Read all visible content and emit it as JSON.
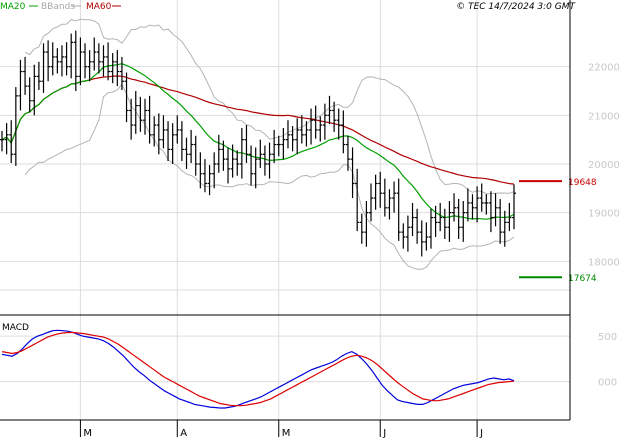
{
  "legend": [
    {
      "label": "MA20",
      "color": "#00a000"
    },
    {
      "label": "BBands",
      "color": "#a8a8a8"
    },
    {
      "label": "MA60",
      "color": "#b00000"
    }
  ],
  "copyright": "© TEC 14/7/2024 3:0 GMT",
  "macd_label": "MACD",
  "colors": {
    "ma20": "#00a000",
    "ma60": "#b00000",
    "bbands": "#b4b4b4",
    "price": "#000000",
    "macd": "#0000dd",
    "signal": "#dd0000",
    "grid": "#dddddd",
    "axis_text": "#c8c8c8",
    "resistance": "#cc0000",
    "support": "#008800"
  },
  "chart_data": [
    {
      "type": "bar",
      "title": "",
      "series_kind": "OHLC daily",
      "y_ticks": [
        {
          "value": 18000,
          "label": "18000"
        },
        {
          "value": 19000,
          "label": "19000"
        },
        {
          "value": 20000,
          "label": "20000"
        },
        {
          "value": 21000,
          "label": "21000"
        },
        {
          "value": 22000,
          "label": "22000"
        }
      ],
      "ylim": [
        17000,
        23000
      ],
      "x_ticks": [
        {
          "index": 17,
          "label": "M"
        },
        {
          "index": 38,
          "label": "A"
        },
        {
          "index": 60,
          "label": "M"
        },
        {
          "index": 82,
          "label": "J"
        },
        {
          "index": 103,
          "label": "J"
        }
      ],
      "n_days": 115,
      "closes": [
        20500,
        20600,
        20200,
        21400,
        21900,
        21600,
        21300,
        21800,
        21700,
        22300,
        22000,
        22200,
        22100,
        22200,
        22000,
        22500,
        21800,
        22300,
        22000,
        22100,
        22300,
        22100,
        22200,
        21900,
        22100,
        21900,
        21700,
        21100,
        20800,
        21200,
        20900,
        21100,
        20600,
        20800,
        20500,
        20700,
        20300,
        20600,
        20700,
        20300,
        20200,
        20400,
        20000,
        19800,
        19600,
        19800,
        20000,
        20300,
        20100,
        19900,
        20100,
        20000,
        20500,
        20200,
        19800,
        20100,
        20200,
        20000,
        20200,
        20400,
        20400,
        20500,
        20600,
        20500,
        20700,
        20600,
        20700,
        20900,
        20700,
        20800,
        21000,
        21100,
        20900,
        20800,
        20400,
        20100,
        19600,
        18800,
        18600,
        19000,
        19300,
        19600,
        19400,
        19100,
        19300,
        19400,
        18600,
        18500,
        18700,
        18900,
        18600,
        18400,
        18500,
        18900,
        18800,
        18900,
        18700,
        19000,
        19100,
        18700,
        19000,
        19200,
        19100,
        19300,
        19200,
        19200,
        18900,
        19100,
        18600,
        18800,
        18900,
        19400
      ],
      "levels": [
        {
          "name": "resistance",
          "value": 19648,
          "label": "19648"
        },
        {
          "name": "support",
          "value": 17674,
          "label": "17674"
        }
      ],
      "indicators": [
        "MA20",
        "MA60",
        "BBands"
      ]
    },
    {
      "type": "line",
      "title": "MACD",
      "y_ticks": [
        {
          "value": 500,
          "label": "500"
        },
        {
          "value": 0,
          "label": "000"
        }
      ],
      "ylim": [
        -400,
        700
      ],
      "series": [
        {
          "name": "MACD",
          "values": [
            300,
            290,
            280,
            310,
            360,
            420,
            470,
            500,
            520,
            540,
            560,
            565,
            560,
            555,
            540,
            520,
            500,
            490,
            480,
            470,
            450,
            420,
            380,
            330,
            280,
            220,
            160,
            110,
            70,
            20,
            -20,
            -60,
            -100,
            -130,
            -160,
            -190,
            -210,
            -230,
            -250,
            -260,
            -270,
            -280,
            -285,
            -290,
            -290,
            -280,
            -270,
            -250,
            -230,
            -210,
            -190,
            -170,
            -140,
            -110,
            -80,
            -50,
            -20,
            10,
            40,
            70,
            100,
            130,
            150,
            170,
            190,
            210,
            240,
            280,
            310,
            330,
            300,
            250,
            190,
            120,
            40,
            -40,
            -100,
            -150,
            -200,
            -220,
            -230,
            -240,
            -250,
            -250,
            -230,
            -200,
            -170,
            -140,
            -110,
            -80,
            -60,
            -40,
            -30,
            -20,
            -10,
            10,
            30,
            40,
            30,
            20,
            30,
            10
          ]
        },
        {
          "name": "Signal",
          "values": [
            330,
            320,
            310,
            320,
            340,
            370,
            400,
            430,
            460,
            490,
            510,
            525,
            535,
            540,
            540,
            535,
            530,
            520,
            510,
            500,
            490,
            470,
            440,
            410,
            370,
            330,
            290,
            250,
            210,
            170,
            130,
            90,
            50,
            20,
            -10,
            -40,
            -70,
            -100,
            -130,
            -160,
            -180,
            -200,
            -220,
            -240,
            -250,
            -260,
            -265,
            -265,
            -260,
            -250,
            -240,
            -230,
            -210,
            -190,
            -160,
            -130,
            -100,
            -70,
            -40,
            -10,
            20,
            50,
            80,
            110,
            140,
            170,
            200,
            230,
            260,
            280,
            290,
            280,
            260,
            230,
            190,
            140,
            90,
            40,
            -10,
            -50,
            -90,
            -130,
            -160,
            -190,
            -200,
            -210,
            -210,
            -200,
            -190,
            -170,
            -150,
            -130,
            -110,
            -90,
            -70,
            -50,
            -30,
            -20,
            -10,
            -5,
            0,
            5
          ]
        }
      ]
    }
  ]
}
